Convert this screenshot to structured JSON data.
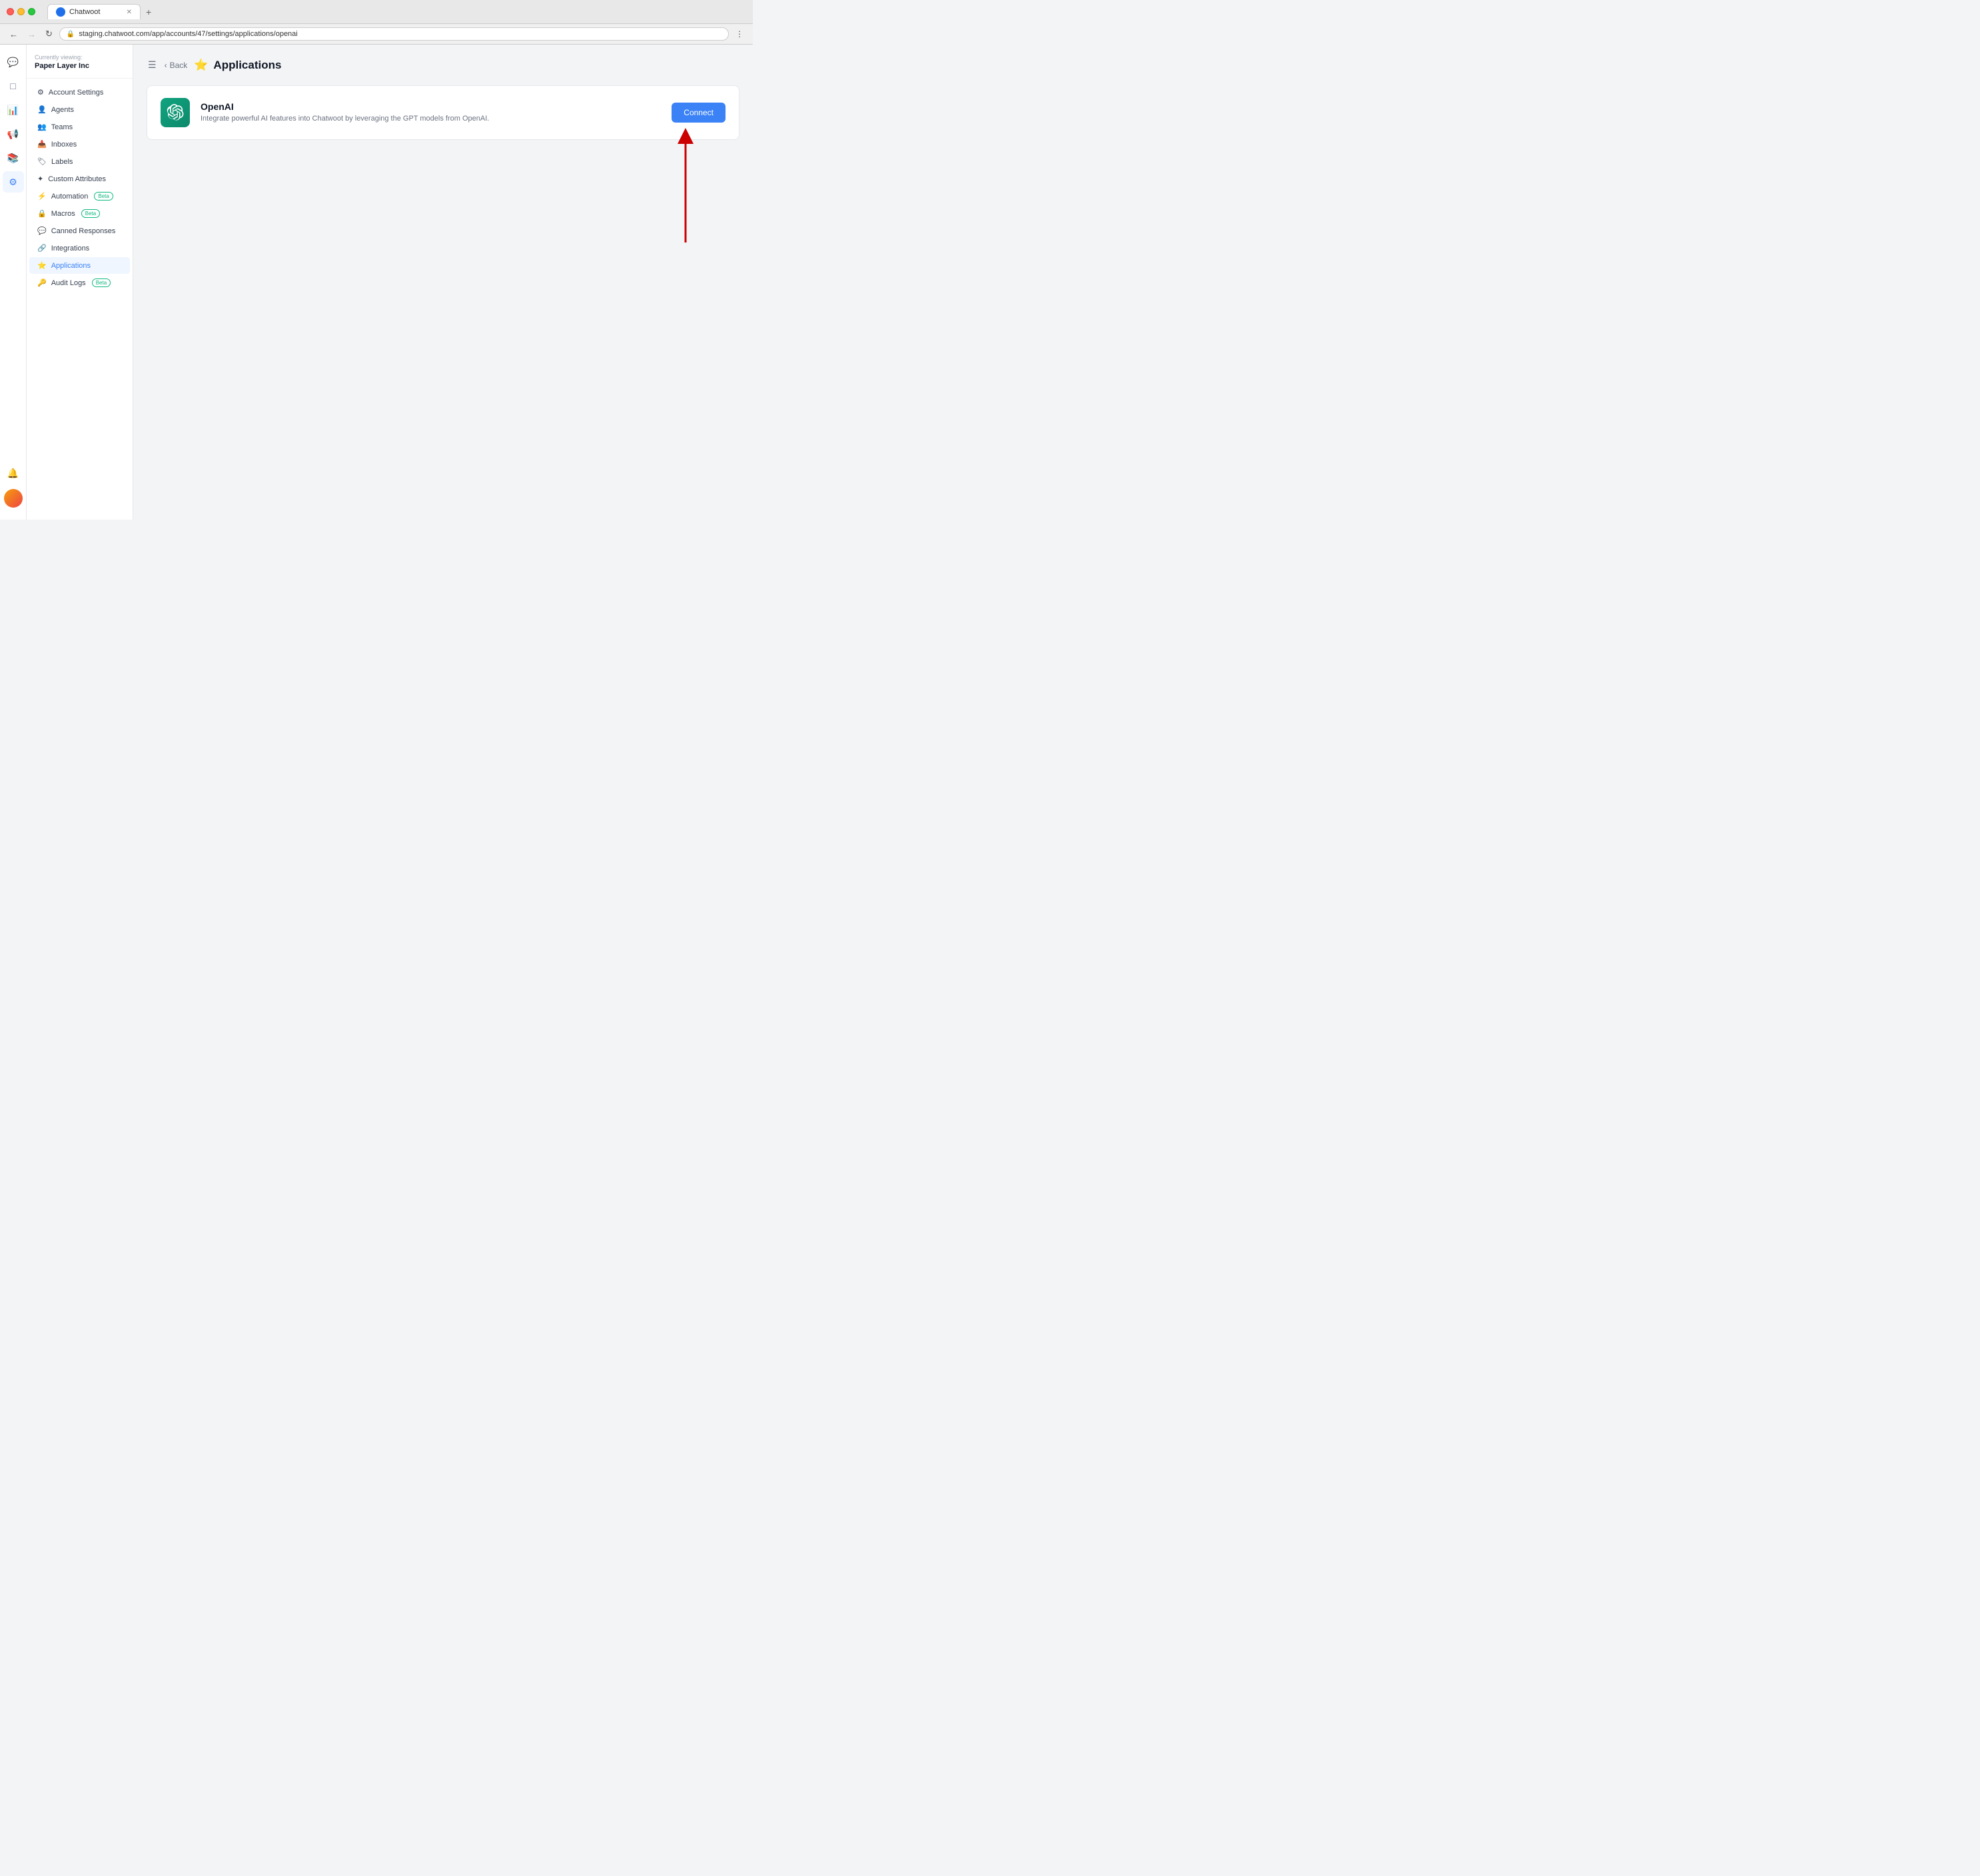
{
  "browser": {
    "tab_title": "Chatwoot",
    "url": "staging.chatwoot.com/app/accounts/47/settings/applications/openai",
    "new_tab_label": "+"
  },
  "app": {
    "current_viewing_label": "Currently viewing:",
    "current_viewing_name": "Paper Layer Inc"
  },
  "sidebar": {
    "items": [
      {
        "id": "account-settings",
        "icon": "⚙",
        "label": "Account Settings",
        "active": false
      },
      {
        "id": "agents",
        "icon": "👤",
        "label": "Agents",
        "active": false
      },
      {
        "id": "teams",
        "icon": "👥",
        "label": "Teams",
        "active": false
      },
      {
        "id": "inboxes",
        "icon": "📥",
        "label": "Inboxes",
        "active": false
      },
      {
        "id": "labels",
        "icon": "🏷",
        "label": "Labels",
        "active": false
      },
      {
        "id": "custom-attributes",
        "icon": "✦",
        "label": "Custom Attributes",
        "active": false
      },
      {
        "id": "automation",
        "icon": "⚡",
        "label": "Automation",
        "badge": "Beta",
        "active": false
      },
      {
        "id": "macros",
        "icon": "🔒",
        "label": "Macros",
        "badge": "Beta",
        "active": false
      },
      {
        "id": "canned-responses",
        "icon": "💬",
        "label": "Canned Responses",
        "active": false
      },
      {
        "id": "integrations",
        "icon": "🔗",
        "label": "Integrations",
        "active": false
      },
      {
        "id": "applications",
        "icon": "⭐",
        "label": "Applications",
        "active": true
      },
      {
        "id": "audit-logs",
        "icon": "🔑",
        "label": "Audit Logs",
        "badge": "Beta",
        "active": false
      }
    ]
  },
  "page": {
    "back_label": "Back",
    "title": "Applications",
    "title_icon": "⭐"
  },
  "openai_app": {
    "name": "OpenAI",
    "description": "Integrate powerful AI features into Chatwoot by leveraging the GPT models from OpenAI.",
    "connect_button": "Connect"
  }
}
